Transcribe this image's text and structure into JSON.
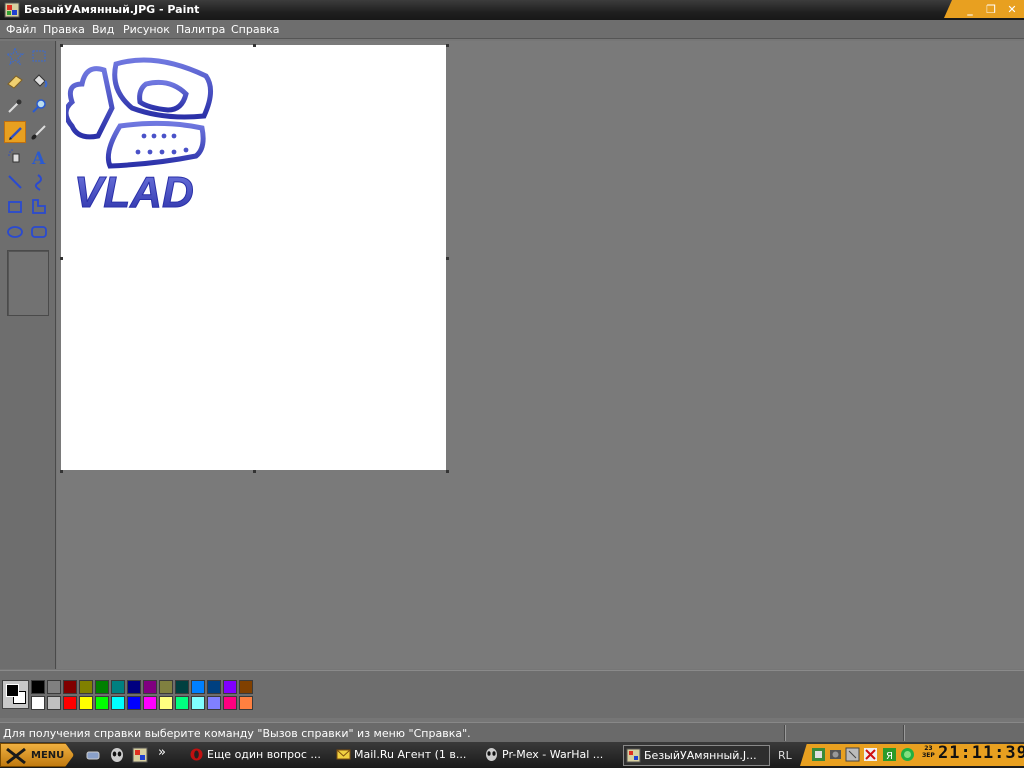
{
  "window": {
    "title": "БезыйУАмянный.JPG - Paint",
    "buttons": [
      "minimize",
      "restore",
      "close"
    ]
  },
  "menu": [
    "Файл",
    "Правка",
    "Вид",
    "Рисунок",
    "Палитра",
    "Справка"
  ],
  "tools": [
    {
      "name": "free-select-tool",
      "icon": "star-select-icon"
    },
    {
      "name": "rect-select-tool",
      "icon": "rect-select-icon"
    },
    {
      "name": "eraser-tool",
      "icon": "eraser-icon"
    },
    {
      "name": "fill-tool",
      "icon": "paint-bucket-icon"
    },
    {
      "name": "color-picker-tool",
      "icon": "eyedropper-icon"
    },
    {
      "name": "magnifier-tool",
      "icon": "magnifier-icon"
    },
    {
      "name": "pencil-tool",
      "icon": "pencil-icon",
      "selected": true
    },
    {
      "name": "brush-tool",
      "icon": "brush-icon"
    },
    {
      "name": "airbrush-tool",
      "icon": "airbrush-icon"
    },
    {
      "name": "text-tool",
      "icon": "text-a-icon"
    },
    {
      "name": "line-tool",
      "icon": "line-icon"
    },
    {
      "name": "curve-tool",
      "icon": "curve-icon"
    },
    {
      "name": "rectangle-tool",
      "icon": "rectangle-icon"
    },
    {
      "name": "polygon-tool",
      "icon": "polygon-icon"
    },
    {
      "name": "ellipse-tool",
      "icon": "ellipse-icon"
    },
    {
      "name": "rounded-rect-tool",
      "icon": "rounded-rect-icon"
    }
  ],
  "canvas": {
    "logo_text": "VLAD",
    "logo_color": "#4a52c8"
  },
  "colors": {
    "foreground": "#000000",
    "background": "#ffffff",
    "palette_top": [
      "#000000",
      "#808080",
      "#800000",
      "#808000",
      "#008000",
      "#008080",
      "#000080",
      "#800080",
      "#808040",
      "#004040",
      "#0080ff",
      "#004080",
      "#8000ff",
      "#804000"
    ],
    "palette_bottom": [
      "#ffffff",
      "#c0c0c0",
      "#ff0000",
      "#ffff00",
      "#00ff00",
      "#00ffff",
      "#0000ff",
      "#ff00ff",
      "#ffff80",
      "#00ff80",
      "#80ffff",
      "#8080ff",
      "#ff0080",
      "#ff8040"
    ]
  },
  "status": {
    "help_text": "Для получения справки выберите команду \"Вызов справки\" из меню \"Справка\"."
  },
  "taskbar": {
    "start_label": "MENU",
    "quicklaunch": [
      "network-icon",
      "alien-icon",
      "paint-icon",
      "more-chevron-icon"
    ],
    "more_label": "»",
    "tasks": [
      {
        "label": "Еще один вопрос ...",
        "icon": "opera-icon",
        "active": false
      },
      {
        "label": "Mail.Ru Агент (1 в...",
        "icon": "envelope-icon",
        "active": false
      },
      {
        "label": "Pr-Mex - WarHal   ...",
        "icon": "alien-icon",
        "active": false
      },
      {
        "label": "БезыйУАмянный.J...",
        "icon": "paint-icon",
        "active": true
      }
    ],
    "language": "RL",
    "tray_icons": [
      "network-status-icon",
      "speaker-icon",
      "shield-icon",
      "antivirus-icon",
      "icq-icon",
      "green-circle-icon"
    ],
    "date_day": "23",
    "date_month": "ЗЕР",
    "clock": "21:11:39"
  }
}
